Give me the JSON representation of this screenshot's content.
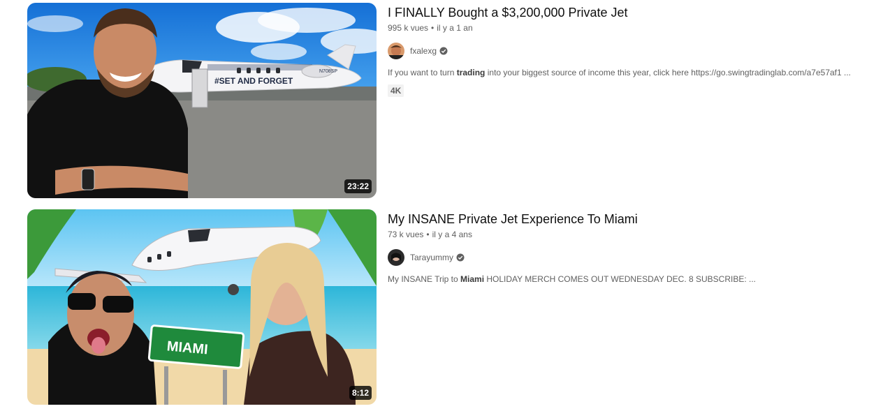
{
  "videos": [
    {
      "title": "I FINALLY Bought a $3,200,000 Private Jet",
      "views": "995 k vues",
      "age": "il y a 1 an",
      "separator": "•",
      "channel": "fxalexg",
      "duration": "23:22",
      "desc_prefix": "If you want to turn ",
      "desc_bold": "trading",
      "desc_suffix": " into your biggest source of income this year, click here https://go.swingtradinglab.com/a7e57af1 ...",
      "badge": "4K",
      "thumb_text": "#SET AND FORGET",
      "tail_number": "N708SP"
    },
    {
      "title": "My INSANE Private Jet Experience To Miami",
      "views": "73 k vues",
      "age": "il y a 4 ans",
      "separator": "•",
      "channel": "Tarayummy",
      "duration": "8:12",
      "desc_prefix": "My INSANE Trip to ",
      "desc_bold": "Miami",
      "desc_suffix": " HOLIDAY MERCH COMES OUT WEDNESDAY DEC. 8 SUBSCRIBE: ...",
      "thumb_text": "MIAMI"
    }
  ],
  "icons": {
    "verified": "verified-check-icon"
  },
  "colors": {
    "text_primary": "#0f0f0f",
    "text_secondary": "#606060",
    "duration_bg": "#000000cc",
    "miami_sign": "#1f8a3c"
  }
}
